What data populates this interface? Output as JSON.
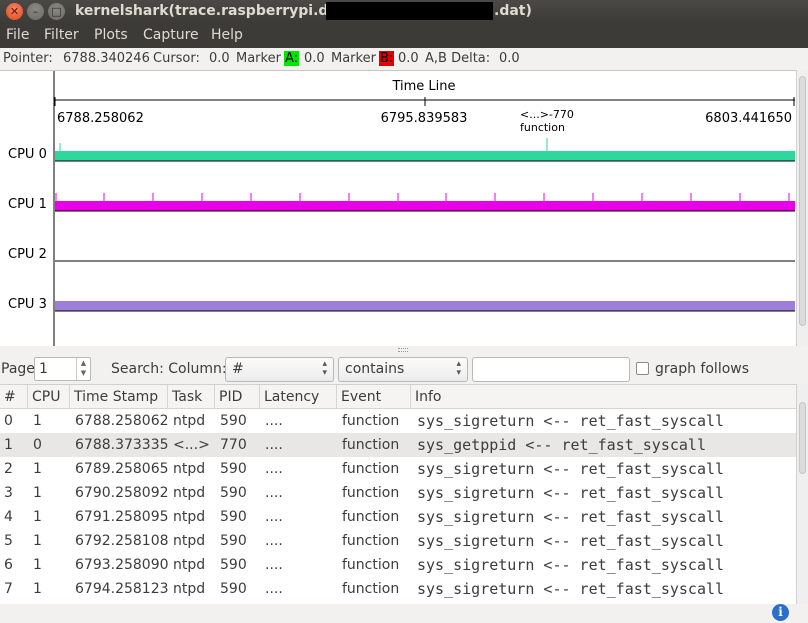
{
  "window": {
    "title_prefix": "kernelshark(trace.raspberrypi.dhcp.",
    "title_suffix": ".dat)"
  },
  "menu": [
    "File",
    "Filter",
    "Plots",
    "Capture",
    "Help"
  ],
  "pointer_bar": {
    "pointer_label": "Pointer:",
    "pointer_value": "6788.340246",
    "cursor_label": "Cursor:",
    "cursor_value": "0.0",
    "marker_label": "Marker",
    "marker_a_tag": "A:",
    "marker_a_value": "0.0",
    "marker_b_tag": "B:",
    "marker_b_value": "0.0",
    "delta_label": "A,B Delta:",
    "delta_value": "0.0"
  },
  "timeline": {
    "title": "Time Line",
    "ts_left": "6788.258062",
    "ts_mid": "6795.839583",
    "ts_right": "6803.441650",
    "annotation_task": "<...>-770",
    "annotation_event": "function"
  },
  "cpus": [
    {
      "label": "CPU 0",
      "color": "#2ed79b"
    },
    {
      "label": "CPU 1",
      "color": "#e800e8"
    },
    {
      "label": "CPU 2",
      "color": ""
    },
    {
      "label": "CPU 3",
      "color": "#9b7fdb"
    }
  ],
  "search": {
    "page_label": "Page",
    "page_value": "1",
    "search_label": "Search: Column:",
    "column_value": "#",
    "mode_value": "contains",
    "query_value": "",
    "graph_follows_label": "graph follows"
  },
  "table": {
    "columns": [
      "#",
      "CPU",
      "Time Stamp",
      "Task",
      "PID",
      "Latency",
      "Event",
      "Info"
    ],
    "rows": [
      {
        "idx": "0",
        "cpu": "1",
        "ts": "6788.258062",
        "task": "ntpd",
        "pid": "590",
        "lat": "....",
        "event": "function",
        "info": "sys_sigreturn <-- ret_fast_syscall"
      },
      {
        "idx": "1",
        "cpu": "0",
        "ts": "6788.373335",
        "task": "<...>",
        "pid": "770",
        "lat": "....",
        "event": "function",
        "info": "sys_getppid <-- ret_fast_syscall"
      },
      {
        "idx": "2",
        "cpu": "1",
        "ts": "6789.258065",
        "task": "ntpd",
        "pid": "590",
        "lat": "....",
        "event": "function",
        "info": "sys_sigreturn <-- ret_fast_syscall"
      },
      {
        "idx": "3",
        "cpu": "1",
        "ts": "6790.258092",
        "task": "ntpd",
        "pid": "590",
        "lat": "....",
        "event": "function",
        "info": "sys_sigreturn <-- ret_fast_syscall"
      },
      {
        "idx": "4",
        "cpu": "1",
        "ts": "6791.258095",
        "task": "ntpd",
        "pid": "590",
        "lat": "....",
        "event": "function",
        "info": "sys_sigreturn <-- ret_fast_syscall"
      },
      {
        "idx": "5",
        "cpu": "1",
        "ts": "6792.258108",
        "task": "ntpd",
        "pid": "590",
        "lat": "....",
        "event": "function",
        "info": "sys_sigreturn <-- ret_fast_syscall"
      },
      {
        "idx": "6",
        "cpu": "1",
        "ts": "6793.258090",
        "task": "ntpd",
        "pid": "590",
        "lat": "....",
        "event": "function",
        "info": "sys_sigreturn <-- ret_fast_syscall"
      },
      {
        "idx": "7",
        "cpu": "1",
        "ts": "6794.258123",
        "task": "ntpd",
        "pid": "590",
        "lat": "....",
        "event": "function",
        "info": "sys_sigreturn <-- ret_fast_syscall"
      }
    ]
  }
}
